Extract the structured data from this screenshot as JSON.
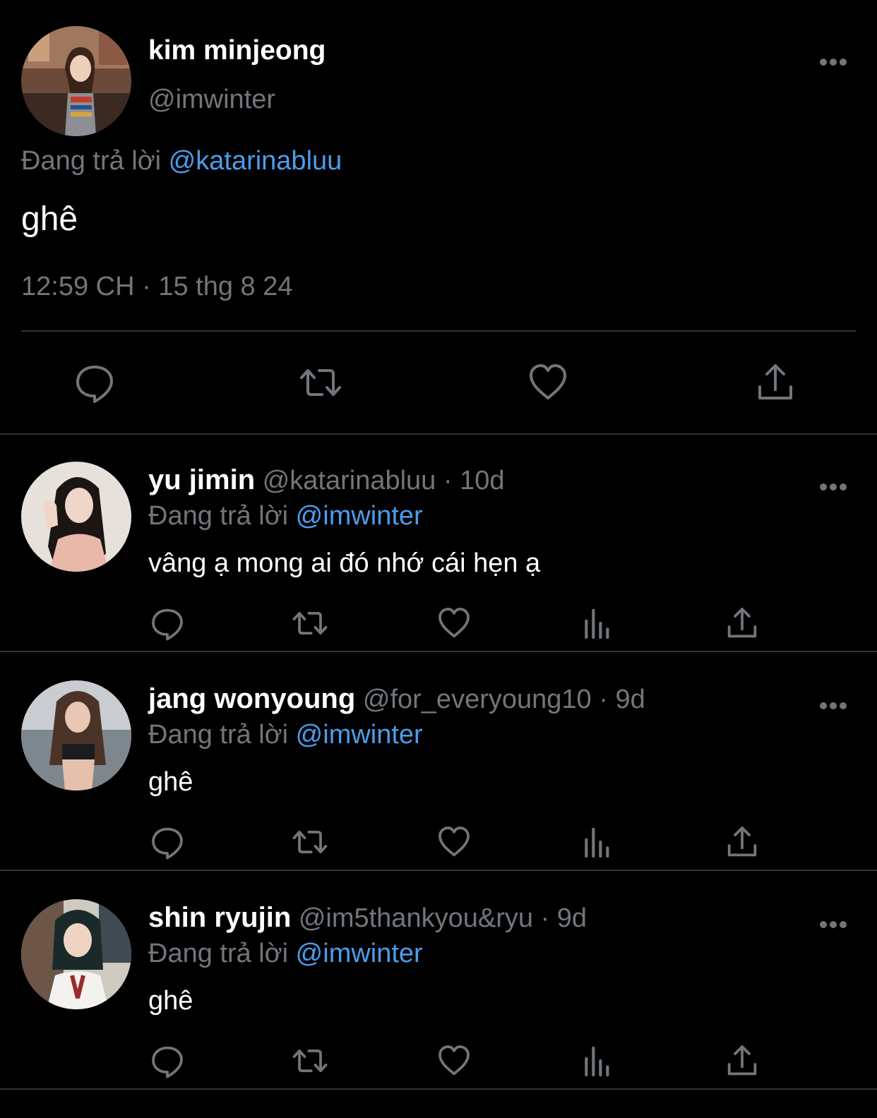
{
  "main_tweet": {
    "name": "kim minjeong",
    "handle": "@imwinter",
    "replying_label": "Đang trả lời",
    "replying_to": "@katarinabluu",
    "text": "ghê",
    "timestamp": "12:59 CH · 15 thg 8 24",
    "actions": [
      "reply-icon",
      "retweet-icon",
      "like-icon",
      "share-icon"
    ]
  },
  "replies": [
    {
      "name": "yu jimin",
      "handle": "@katarinabluu",
      "time": "10d",
      "replying_label": "Đang trả lời",
      "replying_to": "@imwinter",
      "text": "vâng ạ mong ai đó nhớ cái hẹn ạ"
    },
    {
      "name": "jang wonyoung",
      "handle": "@for_everyoung10",
      "time": "9d",
      "replying_label": "Đang trả lời",
      "replying_to": "@imwinter",
      "text": "ghê"
    },
    {
      "name": "shin ryujin",
      "handle": "@im5thankyou&ryu",
      "time": "9d",
      "replying_label": "Đang trả lời",
      "replying_to": "@imwinter",
      "text": "ghê"
    }
  ],
  "separator": "·",
  "colors": {
    "background": "#000000",
    "primary_text": "#ffffff",
    "secondary_text": "#71767b",
    "mention": "#4a9deb",
    "divider": "#2f3336"
  }
}
